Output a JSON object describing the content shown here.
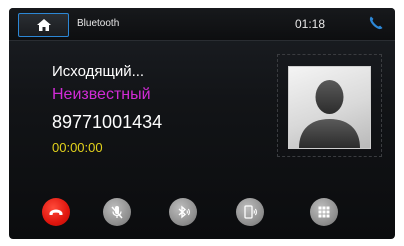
{
  "statusbar": {
    "home_icon": "home-icon",
    "title": "Bluetooth",
    "time": "01:18",
    "phone_icon": "phone-icon"
  },
  "call": {
    "status": "Исходящий...",
    "name": "Неизвестный",
    "number": "89771001434",
    "timer": "00:00:00"
  },
  "avatar": {
    "icon": "person-silhouette"
  },
  "controls": [
    {
      "name": "end-call",
      "icon": "hangup-icon",
      "color": "#e0160e"
    },
    {
      "name": "mute",
      "icon": "mic-off-icon"
    },
    {
      "name": "bluetooth-audio",
      "icon": "bluetooth-icon"
    },
    {
      "name": "phone-audio",
      "icon": "phone-speaker-icon"
    },
    {
      "name": "keypad",
      "icon": "keypad-icon"
    }
  ],
  "colors": {
    "accent": "#2c87d6",
    "name": "#d12bd6",
    "timer": "#e2d21c",
    "end_call": "#e0160e"
  }
}
